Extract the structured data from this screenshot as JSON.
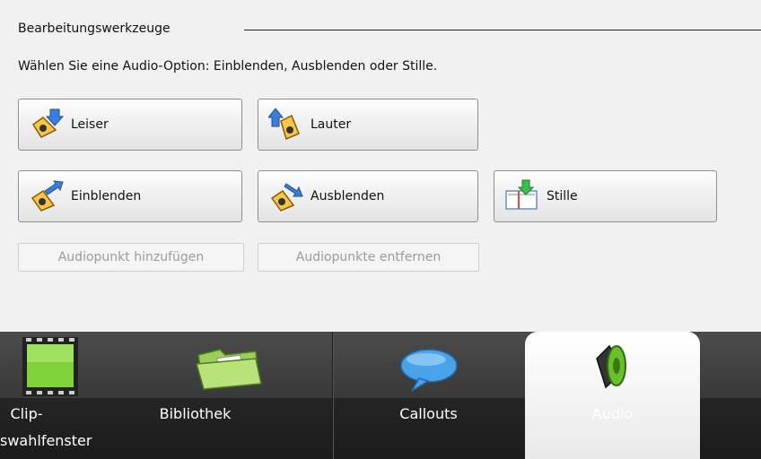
{
  "group": {
    "title": "Bearbeitungswerkzeuge",
    "description": "Wählen Sie eine Audio-Option: Einblenden, Ausblenden oder Stille."
  },
  "buttons": {
    "leiser": "Leiser",
    "lauter": "Lauter",
    "einblenden": "Einblenden",
    "ausblenden": "Ausblenden",
    "stille": "Stille",
    "add_point": "Audiopunkt hinzufügen",
    "remove_points": "Audiopunkte entfernen"
  },
  "tabs": {
    "clip_line1": "Clip-",
    "clip_line2": "swahlfenster",
    "library": "Bibliothek",
    "callouts": "Callouts",
    "audio": "Audio"
  },
  "icons": {
    "leiser": "speaker-down-arrow-icon",
    "lauter": "speaker-up-arrow-icon",
    "einblenden": "speaker-fade-in-icon",
    "ausblenden": "speaker-fade-out-icon",
    "stille": "silence-icon",
    "clip": "film-clip-icon",
    "library": "folder-icon",
    "callouts": "speech-bubble-icon",
    "audio": "speaker-icon"
  }
}
